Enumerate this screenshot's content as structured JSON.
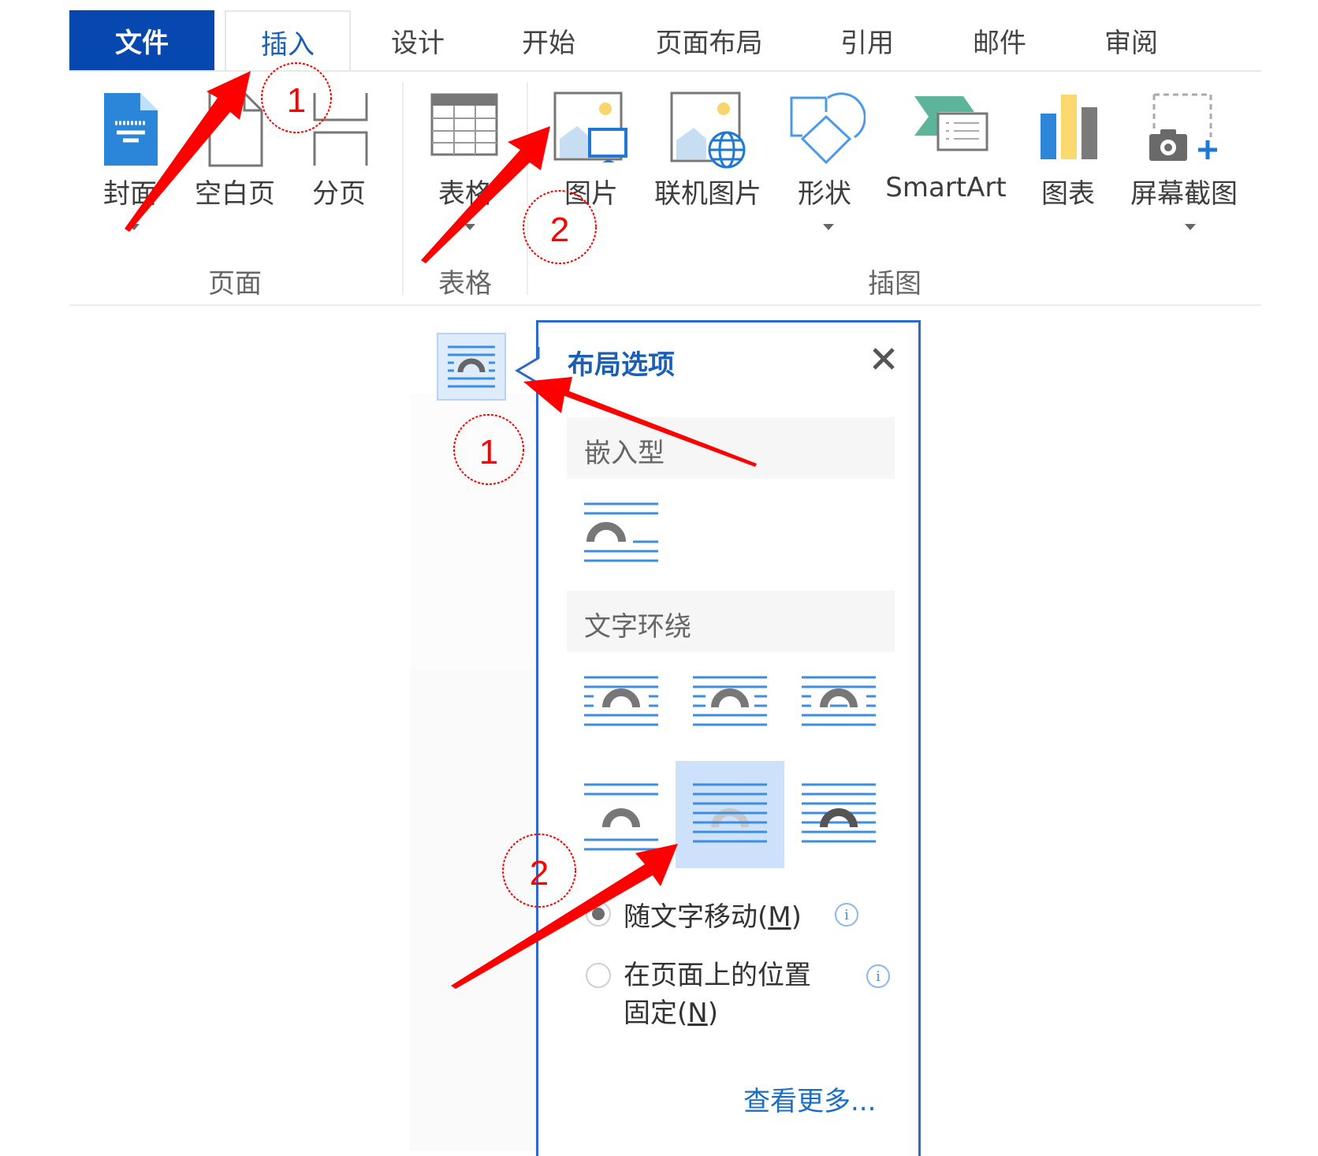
{
  "tabs": [
    {
      "label": "文件",
      "state": "file"
    },
    {
      "label": "插入",
      "state": "active"
    },
    {
      "label": "设计"
    },
    {
      "label": "开始"
    },
    {
      "label": "页面布局"
    },
    {
      "label": "引用"
    },
    {
      "label": "邮件"
    },
    {
      "label": "审阅"
    }
  ],
  "ribbon": {
    "groups": [
      {
        "label": "页面",
        "buttons": [
          {
            "label": "封面",
            "icon": "cover-page-icon",
            "dropdown": true
          },
          {
            "label": "空白页",
            "icon": "blank-page-icon"
          },
          {
            "label": "分页",
            "icon": "page-break-icon"
          }
        ]
      },
      {
        "label": "表格",
        "buttons": [
          {
            "label": "表格",
            "icon": "table-icon",
            "dropdown": true
          }
        ]
      },
      {
        "label": "插图",
        "buttons": [
          {
            "label": "图片",
            "icon": "picture-icon"
          },
          {
            "label": "联机图片",
            "icon": "online-picture-icon"
          },
          {
            "label": "形状",
            "icon": "shapes-icon",
            "dropdown": true
          },
          {
            "label": "SmartArt",
            "icon": "smartart-icon"
          },
          {
            "label": "图表",
            "icon": "chart-icon"
          },
          {
            "label": "屏幕截图",
            "icon": "screenshot-icon",
            "dropdown": true
          }
        ]
      }
    ]
  },
  "layout_panel": {
    "title": "布局选项",
    "close_icon": "close-icon",
    "inline_section": "嵌入型",
    "wrap_section": "文字环绕",
    "wrap_options_selected_index": 4,
    "radio_options": [
      {
        "label": "随文字移动(",
        "key": "M",
        "suffix": ")",
        "checked": true
      },
      {
        "label_line1": "在页面上的位置",
        "label_line2_prefix": "固定(",
        "key": "N",
        "suffix": ")",
        "checked": false
      }
    ],
    "more_link": "查看更多..."
  },
  "annotations": {
    "step1": "1",
    "step2": "2",
    "color": "#ff0000"
  },
  "colors": {
    "file_tab": "#0747b0",
    "accent": "#1a5fb4",
    "panel_border": "#2a6acb",
    "selected_option": "#cde2fa"
  }
}
